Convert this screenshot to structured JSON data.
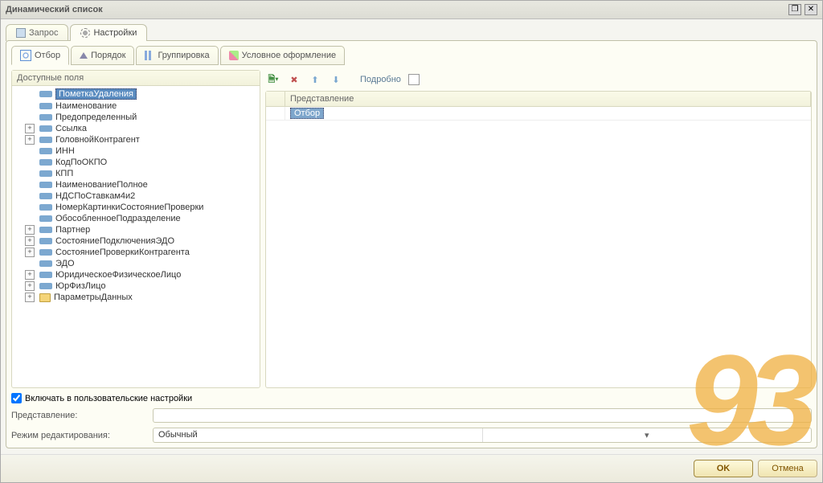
{
  "window": {
    "title": "Динамический список"
  },
  "main_tabs": [
    {
      "label": "Запрос",
      "active": false
    },
    {
      "label": "Настройки",
      "active": true
    }
  ],
  "sub_tabs": [
    {
      "label": "Отбор",
      "active": true
    },
    {
      "label": "Порядок",
      "active": false
    },
    {
      "label": "Группировка",
      "active": false
    },
    {
      "label": "Условное оформление",
      "active": false
    }
  ],
  "fields_header": "Доступные поля",
  "fields": [
    {
      "label": "ПометкаУдаления",
      "expandable": false,
      "selected": true,
      "indent": 1
    },
    {
      "label": "Наименование",
      "expandable": false,
      "indent": 1
    },
    {
      "label": "Предопределенный",
      "expandable": false,
      "indent": 1
    },
    {
      "label": "Ссылка",
      "expandable": true,
      "indent": 0
    },
    {
      "label": "ГоловнойКонтрагент",
      "expandable": true,
      "indent": 0
    },
    {
      "label": "ИНН",
      "expandable": false,
      "indent": 1
    },
    {
      "label": "КодПоОКПО",
      "expandable": false,
      "indent": 1
    },
    {
      "label": "КПП",
      "expandable": false,
      "indent": 1
    },
    {
      "label": "НаименованиеПолное",
      "expandable": false,
      "indent": 1
    },
    {
      "label": "НДСПоСтавкам4и2",
      "expandable": false,
      "indent": 1
    },
    {
      "label": "НомерКартинкиСостояниеПроверки",
      "expandable": false,
      "indent": 1
    },
    {
      "label": "ОбособленноеПодразделение",
      "expandable": false,
      "indent": 1
    },
    {
      "label": "Партнер",
      "expandable": true,
      "indent": 0
    },
    {
      "label": "СостояниеПодключенияЭДО",
      "expandable": true,
      "indent": 0
    },
    {
      "label": "СостояниеПроверкиКонтрагента",
      "expandable": true,
      "indent": 0
    },
    {
      "label": "ЭДО",
      "expandable": false,
      "indent": 1
    },
    {
      "label": "ЮридическоеФизическоеЛицо",
      "expandable": true,
      "indent": 0
    },
    {
      "label": "ЮрФизЛицо",
      "expandable": true,
      "indent": 0
    },
    {
      "label": "ПараметрыДанных",
      "expandable": true,
      "indent": 0,
      "folder": true
    }
  ],
  "toolbar": {
    "details": "Подробно"
  },
  "grid": {
    "header": "Представление",
    "rows": [
      {
        "label": "Отбор",
        "selected": true
      }
    ]
  },
  "checkbox": {
    "label": "Включать в пользовательские настройки",
    "checked": true
  },
  "representation_label": "Представление:",
  "edit_mode_label": "Режим редактирования:",
  "edit_mode_value": "Обычный",
  "footer": {
    "ok": "OK",
    "cancel": "Отмена"
  },
  "watermark": "93"
}
